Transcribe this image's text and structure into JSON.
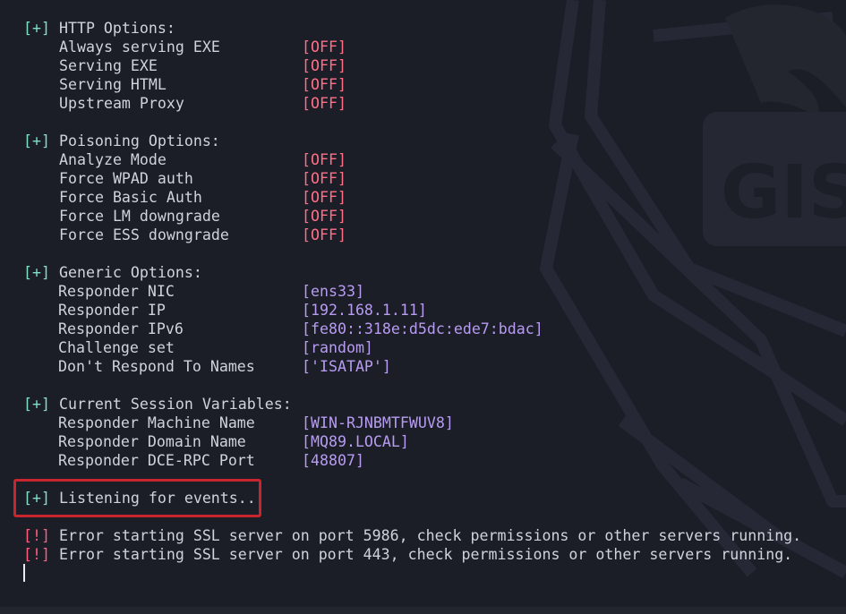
{
  "watermark": {
    "text": "GIS",
    "icon": "hacker-logo-watermark"
  },
  "colors": {
    "background": "#1b1d27",
    "marker_ok": "#7fe0c4",
    "marker_error": "#ff5e7d",
    "value_off": "#ff6f86",
    "value_info": "#b79cf1",
    "highlight": "#c8252f"
  },
  "sections": {
    "http": {
      "marker": "[+]",
      "title": " HTTP Options:",
      "items": [
        {
          "label": "Always serving EXE",
          "value": "[OFF]"
        },
        {
          "label": "Serving EXE",
          "value": "[OFF]"
        },
        {
          "label": "Serving HTML",
          "value": "[OFF]"
        },
        {
          "label": "Upstream Proxy",
          "value": "[OFF]"
        }
      ]
    },
    "poisoning": {
      "marker": "[+]",
      "title": " Poisoning Options:",
      "items": [
        {
          "label": "Analyze Mode",
          "value": "[OFF]"
        },
        {
          "label": "Force WPAD auth",
          "value": "[OFF]"
        },
        {
          "label": "Force Basic Auth",
          "value": "[OFF]"
        },
        {
          "label": "Force LM downgrade",
          "value": "[OFF]"
        },
        {
          "label": "Force ESS downgrade",
          "value": "[OFF]"
        }
      ]
    },
    "generic": {
      "marker": "[+]",
      "title": " Generic Options:",
      "items": [
        {
          "label": "Responder NIC",
          "value": "[ens33]"
        },
        {
          "label": "Responder IP",
          "value": "[192.168.1.11]"
        },
        {
          "label": "Responder IPv6",
          "value": "[fe80::318e:d5dc:ede7:bdac]"
        },
        {
          "label": "Challenge set",
          "value": "[random]"
        },
        {
          "label": "Don't Respond To Names",
          "value": "['ISATAP']"
        }
      ]
    },
    "session": {
      "marker": "[+]",
      "title": " Current Session Variables:",
      "items": [
        {
          "label": "Responder Machine Name",
          "value": "[WIN-RJNBMTFWUV8]"
        },
        {
          "label": "Responder Domain Name",
          "value": "[MQ89.LOCAL]"
        },
        {
          "label": "Responder DCE-RPC Port",
          "value": "[48807]"
        }
      ]
    }
  },
  "listening": {
    "marker": "[+]",
    "text": " Listening for events..."
  },
  "errors": [
    {
      "marker": "[!]",
      "text": " Error starting SSL server on port 5986, check permissions or other servers running."
    },
    {
      "marker": "[!]",
      "text": " Error starting SSL server on port 443, check permissions or other servers running."
    }
  ]
}
